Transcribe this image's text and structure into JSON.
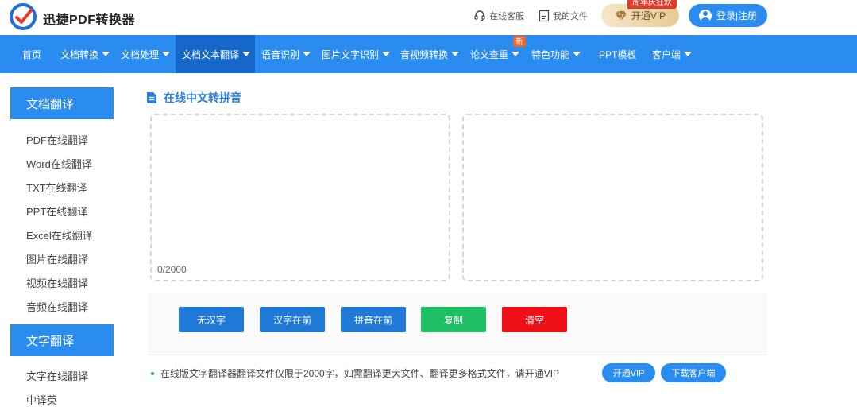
{
  "header": {
    "brand": "迅捷PDF转换器",
    "service_label": "在线客服",
    "files_label": "我的文件",
    "vip_tag": "周年庆狂欢",
    "vip_label": "开通VIP",
    "login_label": "登录|注册"
  },
  "nav": {
    "items": [
      {
        "label": "首页"
      },
      {
        "label": "文档转换"
      },
      {
        "label": "文档处理"
      },
      {
        "label": "文档文本翻译"
      },
      {
        "label": "语音识别"
      },
      {
        "label": "图片文字识别"
      },
      {
        "label": "音视频转换"
      },
      {
        "label": "论文查重"
      },
      {
        "label": "特色功能"
      },
      {
        "label": "PPT模板"
      },
      {
        "label": "客户端"
      }
    ],
    "new_badge": "新"
  },
  "sidebar": {
    "section1": {
      "title": "文档翻译",
      "items": [
        "PDF在线翻译",
        "Word在线翻译",
        "TXT在线翻译",
        "PPT在线翻译",
        "Excel在线翻译",
        "图片在线翻译",
        "视频在线翻译",
        "音频在线翻译"
      ]
    },
    "section2": {
      "title": "文字翻译",
      "items": [
        "文字在线翻译",
        "中译英"
      ]
    }
  },
  "main": {
    "title": "在线中文转拼音",
    "counter": "0/2000",
    "buttons": {
      "no_hanzi": "无汉字",
      "hanzi_first": "汉字在前",
      "pinyin_first": "拼音在前",
      "copy": "复制",
      "clear": "清空"
    },
    "note": "在线版文字翻译器翻译文件仅限于2000字，如需翻译更大文件、翻译更多格式文件，请开通VIP",
    "vip_button": "开通VIP",
    "download_button": "下载客户端"
  },
  "colors": {
    "primary": "#2b8cf0",
    "nav_active": "#1568c9",
    "action_blue": "#1f7ad7",
    "copy_green": "#1fbf63",
    "clear_red": "#f0101a"
  }
}
